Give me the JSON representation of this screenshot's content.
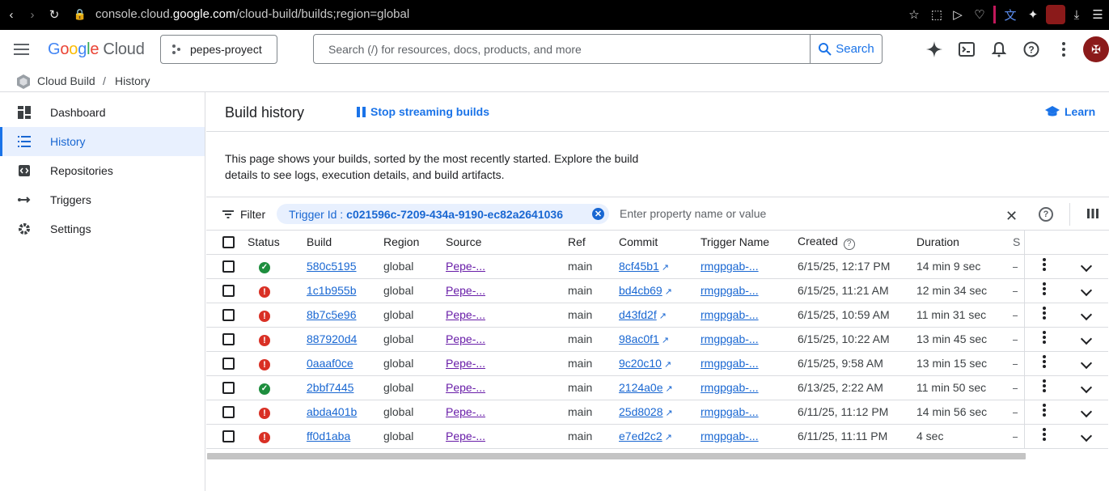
{
  "browser": {
    "url_host_prefix": "console.cloud.",
    "url_host": "google.com",
    "url_path": "/cloud-build/builds;region=global"
  },
  "appbar": {
    "logo_letters": [
      "G",
      "o",
      "o",
      "g",
      "l",
      "e"
    ],
    "logo_cloud": "Cloud",
    "project": "pepes-proyect",
    "search_placeholder": "Search (/) for resources, docs, products, and more",
    "search_button": "Search"
  },
  "breadcrumb": {
    "product": "Cloud Build",
    "separator": "/",
    "page": "History"
  },
  "sidebar": {
    "items": [
      {
        "label": "Dashboard",
        "icon": "dashboard-icon"
      },
      {
        "label": "History",
        "icon": "list-icon"
      },
      {
        "label": "Repositories",
        "icon": "repo-icon"
      },
      {
        "label": "Triggers",
        "icon": "trigger-icon"
      },
      {
        "label": "Settings",
        "icon": "gear-icon"
      }
    ]
  },
  "header": {
    "title": "Build history",
    "stream_button": "Stop streaming builds",
    "learn": "Learn"
  },
  "description": "This page shows your builds, sorted by the most recently started. Explore the build details to see logs, execution details, and build artifacts.",
  "filter": {
    "label": "Filter",
    "chip_key": "Trigger Id :",
    "chip_value": "c021596c-7209-434a-9190-ec82a2641036",
    "input_placeholder": "Enter property name or value"
  },
  "table": {
    "columns": [
      "Status",
      "Build",
      "Region",
      "Source",
      "Ref",
      "Commit",
      "Trigger Name",
      "Created",
      "Duration",
      "S"
    ],
    "rows": [
      {
        "status": "success",
        "build": "580c5195",
        "region": "global",
        "source": "Pepe-...",
        "ref": "main",
        "commit": "8cf45b1",
        "trigger": "rmgpgab-...",
        "created": "6/15/25, 12:17 PM",
        "duration": "14 min 9 sec"
      },
      {
        "status": "failed",
        "build": "1c1b955b",
        "region": "global",
        "source": "Pepe-...",
        "ref": "main",
        "commit": "bd4cb69",
        "trigger": "rmgpgab-...",
        "created": "6/15/25, 11:21 AM",
        "duration": "12 min 34 sec"
      },
      {
        "status": "failed",
        "build": "8b7c5e96",
        "region": "global",
        "source": "Pepe-...",
        "ref": "main",
        "commit": "d43fd2f",
        "trigger": "rmgpgab-...",
        "created": "6/15/25, 10:59 AM",
        "duration": "11 min 31 sec"
      },
      {
        "status": "failed",
        "build": "887920d4",
        "region": "global",
        "source": "Pepe-...",
        "ref": "main",
        "commit": "98ac0f1",
        "trigger": "rmgpgab-...",
        "created": "6/15/25, 10:22 AM",
        "duration": "13 min 45 sec"
      },
      {
        "status": "failed",
        "build": "0aaaf0ce",
        "region": "global",
        "source": "Pepe-...",
        "ref": "main",
        "commit": "9c20c10",
        "trigger": "rmgpgab-...",
        "created": "6/15/25, 9:58 AM",
        "duration": "13 min 15 sec"
      },
      {
        "status": "success",
        "build": "2bbf7445",
        "region": "global",
        "source": "Pepe-...",
        "ref": "main",
        "commit": "2124a0e",
        "trigger": "rmgpgab-...",
        "created": "6/13/25, 2:22 AM",
        "duration": "11 min 50 sec"
      },
      {
        "status": "failed",
        "build": "abda401b",
        "region": "global",
        "source": "Pepe-...",
        "ref": "main",
        "commit": "25d8028",
        "trigger": "rmgpgab-...",
        "created": "6/11/25, 11:12 PM",
        "duration": "14 min 56 sec"
      },
      {
        "status": "failed",
        "build": "ff0d1aba",
        "region": "global",
        "source": "Pepe-...",
        "ref": "main",
        "commit": "e7ed2c2",
        "trigger": "rmgpgab-...",
        "created": "6/11/25, 11:11 PM",
        "duration": "4 sec"
      }
    ]
  },
  "colors": {
    "accent": "#1a73e8",
    "success": "#1e8e3e",
    "error": "#d93025",
    "source_link": "#681da8"
  }
}
